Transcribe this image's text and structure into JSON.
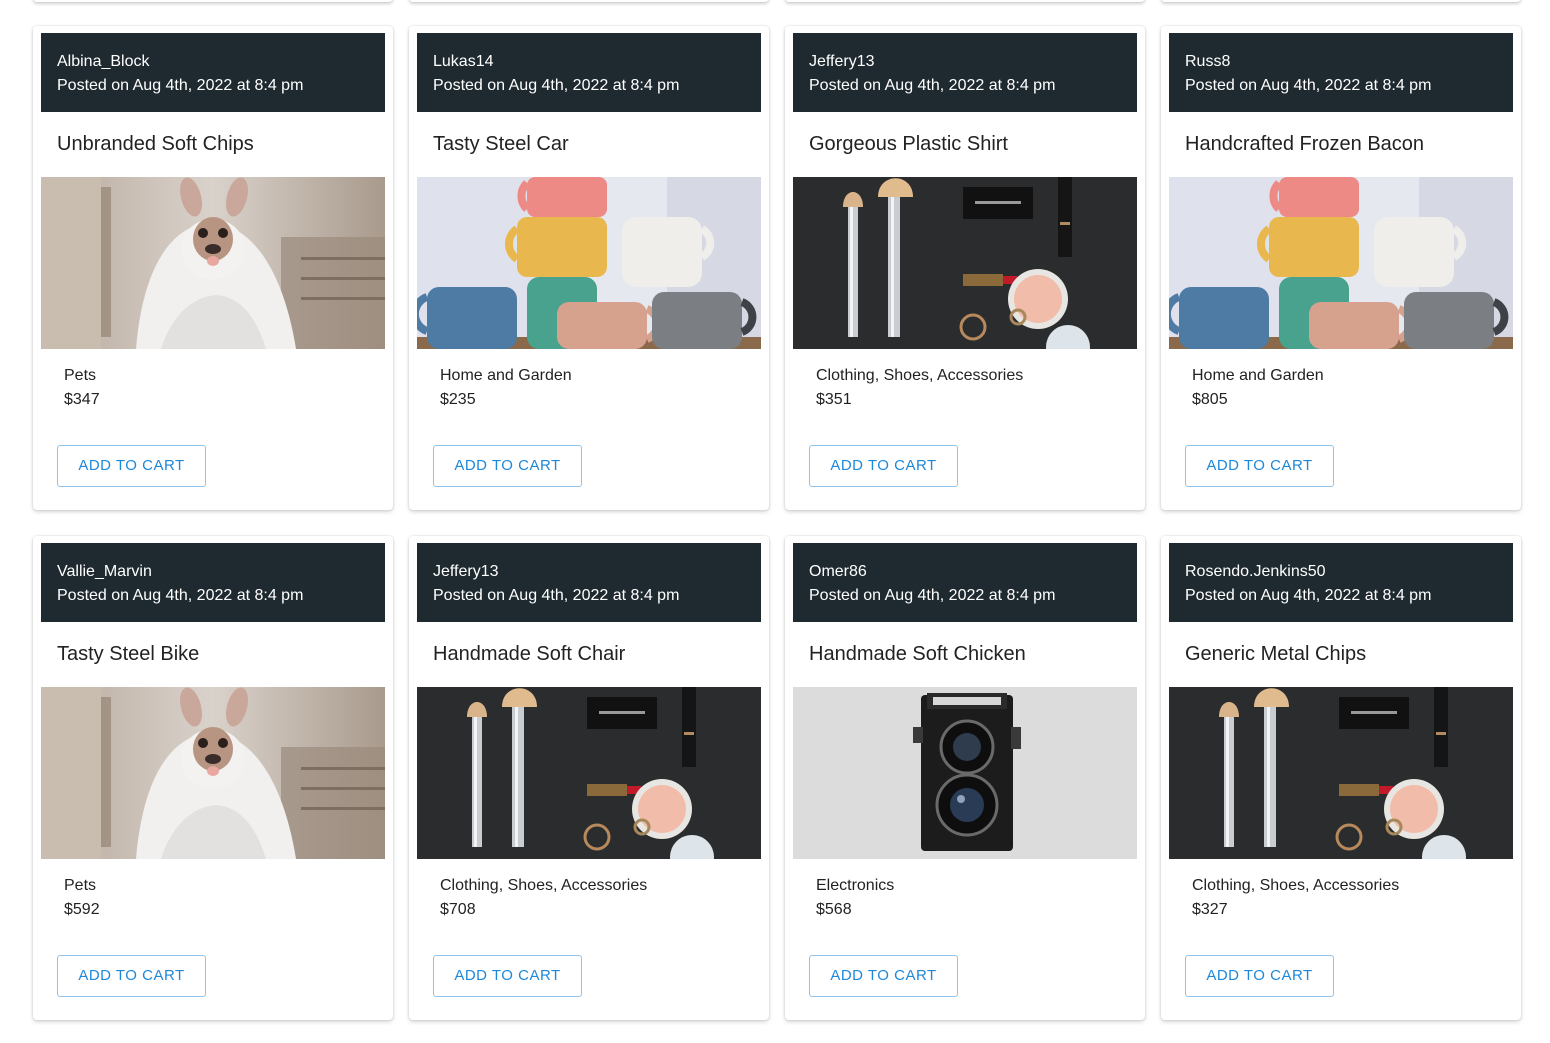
{
  "add_to_cart_label": "ADD TO CART",
  "colors": {
    "header_bg": "#1f2a30",
    "button_text": "#1e88d9",
    "button_border": "#8fc3ea"
  },
  "products": [
    {
      "author": "Albina_Block",
      "posted": "Posted on Aug 4th, 2022 at 8:4 pm",
      "title": "Unbranded Soft Chips",
      "image": "dog-ghost",
      "category": "Pets",
      "price": "$347"
    },
    {
      "author": "Lukas14",
      "posted": "Posted on Aug 4th, 2022 at 8:4 pm",
      "title": "Tasty Steel Car",
      "image": "mugs",
      "category": "Home and Garden",
      "price": "$235"
    },
    {
      "author": "Jeffery13",
      "posted": "Posted on Aug 4th, 2022 at 8:4 pm",
      "title": "Gorgeous Plastic Shirt",
      "image": "makeup",
      "category": "Clothing, Shoes, Accessories",
      "price": "$351"
    },
    {
      "author": "Russ8",
      "posted": "Posted on Aug 4th, 2022 at 8:4 pm",
      "title": "Handcrafted Frozen Bacon",
      "image": "mugs",
      "category": "Home and Garden",
      "price": "$805"
    },
    {
      "author": "Vallie_Marvin",
      "posted": "Posted on Aug 4th, 2022 at 8:4 pm",
      "title": "Tasty Steel Bike",
      "image": "dog-ghost",
      "category": "Pets",
      "price": "$592"
    },
    {
      "author": "Jeffery13",
      "posted": "Posted on Aug 4th, 2022 at 8:4 pm",
      "title": "Handmade Soft Chair",
      "image": "makeup",
      "category": "Clothing, Shoes, Accessories",
      "price": "$708"
    },
    {
      "author": "Omer86",
      "posted": "Posted on Aug 4th, 2022 at 8:4 pm",
      "title": "Handmade Soft Chicken",
      "image": "camera",
      "category": "Electronics",
      "price": "$568"
    },
    {
      "author": "Rosendo.Jenkins50",
      "posted": "Posted on Aug 4th, 2022 at 8:4 pm",
      "title": "Generic Metal Chips",
      "image": "makeup",
      "category": "Clothing, Shoes, Accessories",
      "price": "$327"
    }
  ]
}
